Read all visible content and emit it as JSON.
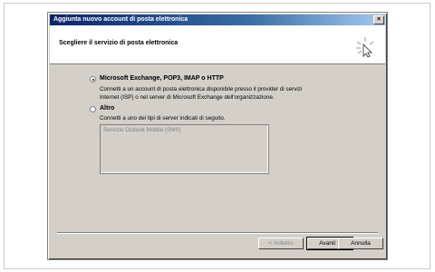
{
  "window": {
    "title": "Aggiunta nuovo account di posta elettronica"
  },
  "header": {
    "title": "Scegliere il servizio di posta elettronica"
  },
  "options": [
    {
      "label": "Microsoft Exchange, POP3, IMAP o HTTP",
      "description": "Connetti a un account di posta elettronica disponibile presso il provider di servizi\nInternet (ISP) o nel server di Microsoft Exchange dell'organizzazione.",
      "selected": true
    },
    {
      "label": "Altro",
      "description": "Connetti a uno dei tipi di server indicati di seguito.",
      "selected": false
    }
  ],
  "other_list": {
    "items": [
      "Servizio Outlook Mobile (SMS)"
    ]
  },
  "buttons": {
    "back": "< Indietro",
    "next": "Avanti >",
    "cancel": "Annulla"
  },
  "icons": {
    "close": "close-icon",
    "wizard": "magic-wand-icon"
  }
}
